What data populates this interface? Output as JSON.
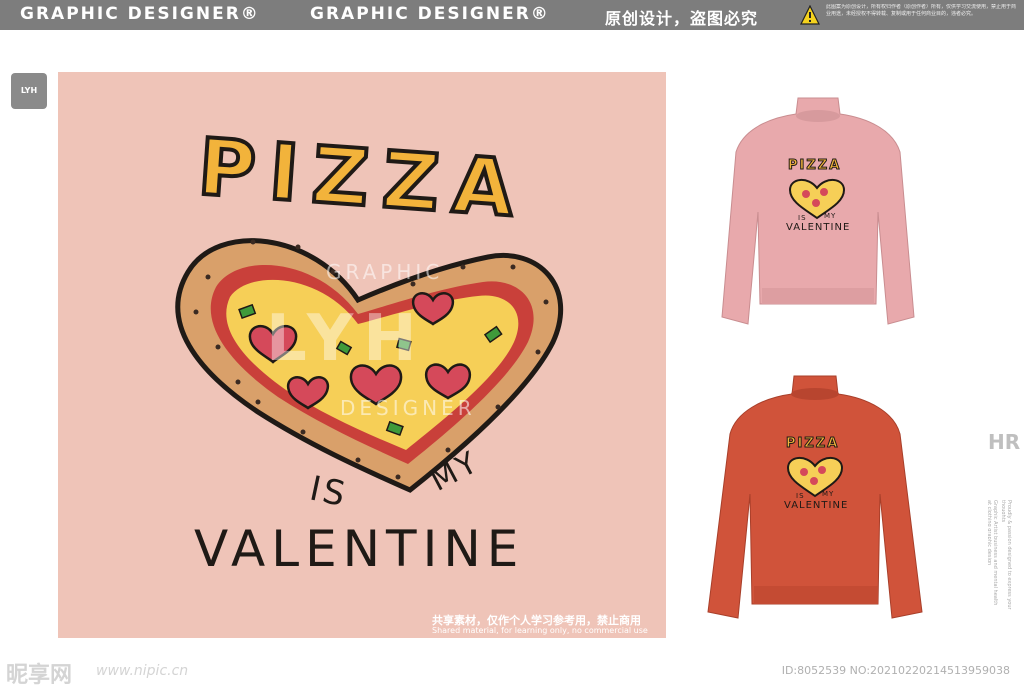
{
  "header": {
    "title_left": "GRAPHIC DESIGNER®",
    "title_mid": "GRAPHIC DESIGNER®",
    "title_right": "原创设计，盗图必究",
    "notice": "此图案为原创设计，所有权归作者（原创作者）所有，仅供学习交流使用，禁止用于商业用途，未经授权不得转载、复制或用于任何商业目的，违者必究。"
  },
  "logo_badge": "LYH",
  "artwork": {
    "title": "PIZZA",
    "word_is": "IS",
    "word_my": "MY",
    "word_valentine": "VALENTINE",
    "watermark_top": "GRAPHIC",
    "watermark_mid": "LYH",
    "watermark_bottom": "DESIGNER",
    "share_cn": "共享素材，仅作个人学习参考用，禁止商用",
    "share_en": "Shared material, for learning only, no commercial use"
  },
  "mockups": {
    "pink": {
      "title": "PIZZA",
      "is": "IS",
      "my": "MY",
      "valentine": "VALENTINE",
      "color": "#e8a9ac"
    },
    "orange": {
      "title": "PIZZA",
      "is": "IS",
      "my": "MY",
      "valentine": "VALENTINE",
      "color": "#d0533a"
    }
  },
  "side": {
    "hr_logo": "HR",
    "text_a": "Graphic Artist business and mental health at clothing graphic design",
    "text_b": "Proudly & passion designed to express your thoughts"
  },
  "footer": {
    "site_logo": "昵享网",
    "url": "www.nipic.cn",
    "id_text": "ID:8052539 NO:20210220214513959038"
  },
  "colors": {
    "background": "#efc4b8",
    "crust": "#d9a06a",
    "sauce": "#c9403a",
    "cheese": "#f6cf57",
    "pepperoni": "#d5495a",
    "pepper": "#3f9a3a",
    "ink": "#1f1a16"
  }
}
